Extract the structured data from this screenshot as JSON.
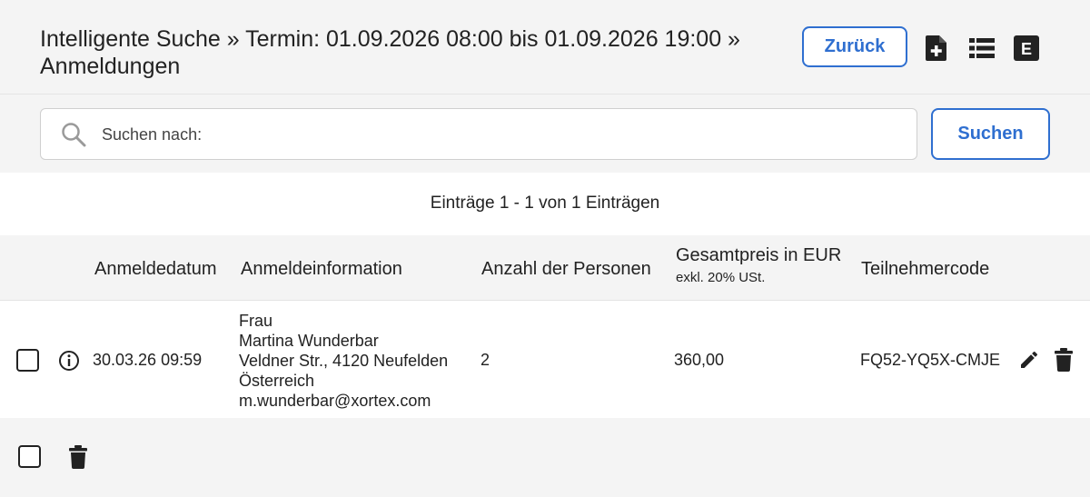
{
  "header": {
    "title_line1": "Intelligente Suche » Termin: 01.09.2026 08:00 bis 01.09.2026 19:00 »",
    "title_line2": "Anmeldungen",
    "back_button": "Zurück",
    "icons": [
      "file-plus-icon",
      "list-icon",
      "excel-icon"
    ],
    "excel_letter": "E"
  },
  "search": {
    "placeholder": "Suchen nach:",
    "button": "Suchen"
  },
  "table": {
    "summary": "Einträge 1 - 1 von 1 Einträgen",
    "columns": {
      "date": "Anmeldedatum",
      "info": "Anmeldeinformation",
      "persons": "Anzahl der Personen",
      "price": "Gesamtpreis in EUR",
      "price_note": "exkl. 20% USt.",
      "code": "Teilnehmercode"
    },
    "rows": [
      {
        "checked": false,
        "date": "30.03.26 09:59",
        "info": [
          "Frau",
          "Martina Wunderbar",
          "Veldner Str., 4120 Neufelden",
          "Österreich",
          "m.wunderbar@xortex.com"
        ],
        "persons": "2",
        "price": "360,00",
        "code": "FQ52-YQ5X-CMJE"
      }
    ]
  },
  "colors": {
    "accent": "#2f6fd0",
    "header_bg": "#f4f4f4"
  }
}
